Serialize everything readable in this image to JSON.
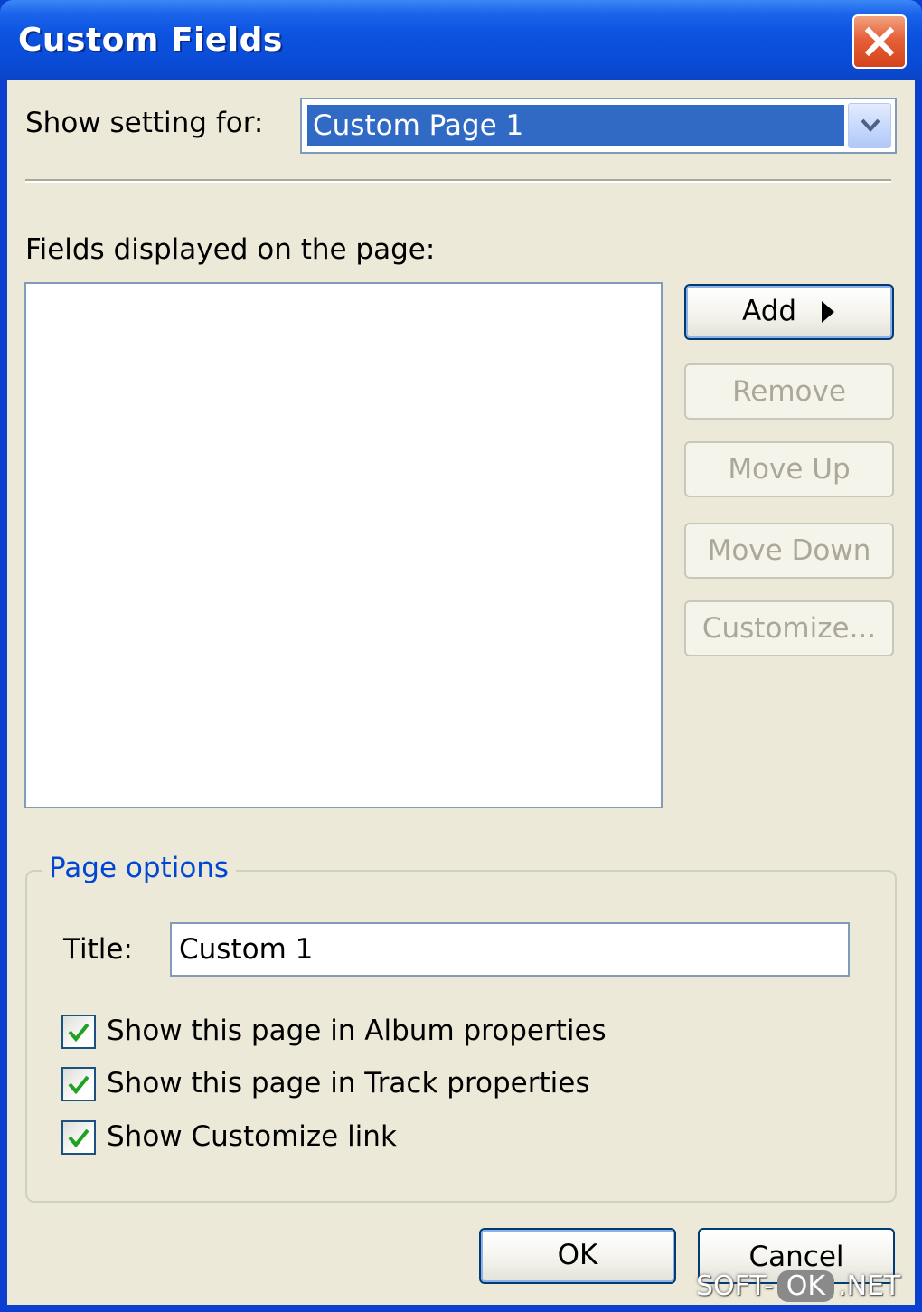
{
  "window": {
    "title": "Custom Fields"
  },
  "show_setting": {
    "label": "Show setting for:",
    "selected": "Custom Page 1"
  },
  "fields": {
    "label": "Fields displayed on the page:",
    "items": []
  },
  "buttons": {
    "add": "Add",
    "remove": "Remove",
    "move_up": "Move Up",
    "move_down": "Move Down",
    "customize": "Customize..."
  },
  "page_options": {
    "legend": "Page options",
    "title_label": "Title:",
    "title_value": "Custom 1",
    "checkboxes": [
      {
        "label": "Show this page in Album properties",
        "checked": true
      },
      {
        "label": "Show this page in Track properties",
        "checked": true
      },
      {
        "label": "Show Customize link",
        "checked": true
      }
    ]
  },
  "footer": {
    "ok": "OK",
    "cancel": "Cancel"
  },
  "watermark": {
    "left": "SOFT-",
    "middle": "OK",
    "right": ".NET"
  },
  "colors": {
    "titlebar": "#0a4bd6",
    "dialog_bg": "#ece9d8",
    "selection": "#316ac5",
    "group_legend": "#0046d5",
    "close_button": "#d5431c",
    "checkmark": "#21a121"
  }
}
